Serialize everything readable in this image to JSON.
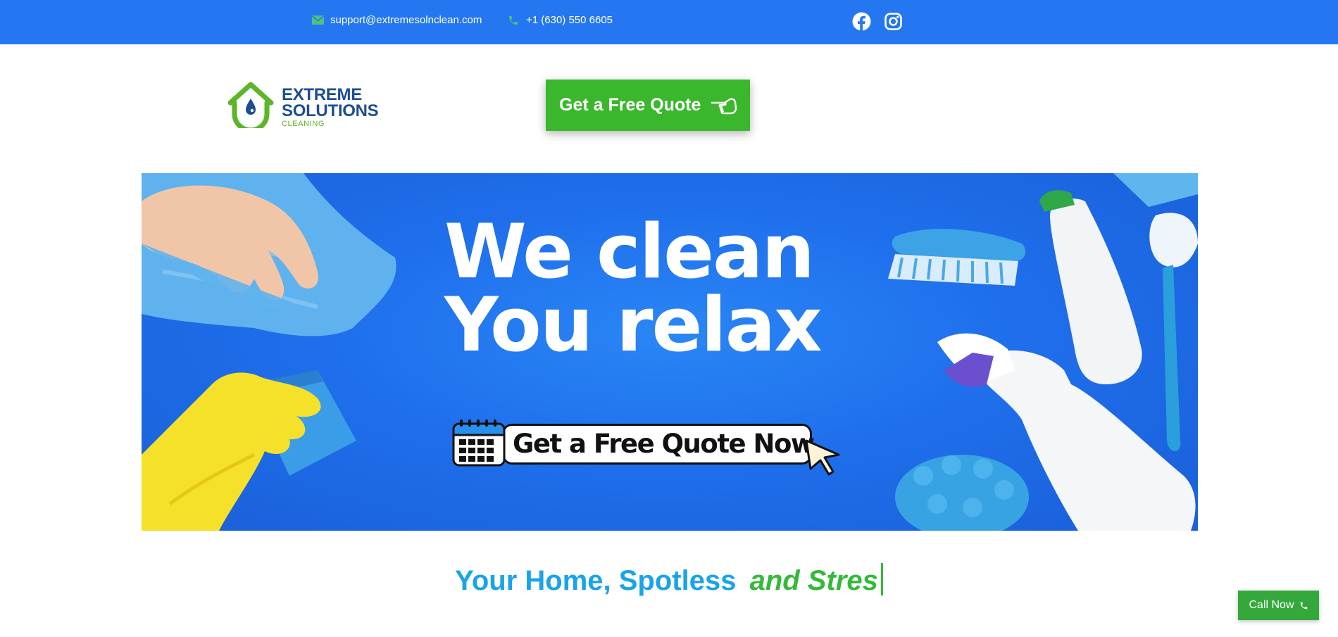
{
  "topbar": {
    "email": "support@extremesolnclean.com",
    "phone": "+1 (630) 550 6605",
    "icons": {
      "email": "envelope-icon",
      "phone": "phone-icon",
      "facebook": "facebook-icon",
      "instagram": "instagram-icon"
    },
    "colors": {
      "background": "#2477f0",
      "icon": "#54c07c"
    }
  },
  "logo": {
    "line1": "EXTREME",
    "line2": "SOLUTIONS",
    "line3": "CLEANING",
    "colors": {
      "house": "#5db52a",
      "drop": "#1d4e91",
      "text": "#1d4e91"
    }
  },
  "quote_button": {
    "label": "Get a Free Quote",
    "icon": "pointing-hand-icon",
    "color": "#3ab72c"
  },
  "hero": {
    "headline_line1": "We clean",
    "headline_line2": "You relax",
    "cta_label": "Get a Free Quote Now",
    "icons": {
      "calendar": "calendar-icon",
      "cursor": "cursor-pointer-icon"
    },
    "colors": {
      "background": "#1f6fec"
    }
  },
  "tagline": {
    "part1": "Your Home, Spotless",
    "part2": "and Stres",
    "colors": {
      "part1": "#1aa3ea",
      "part2": "#35b93a"
    }
  },
  "call_now": {
    "label": "Call Now",
    "icon": "phone-icon",
    "color": "#35a83c"
  }
}
